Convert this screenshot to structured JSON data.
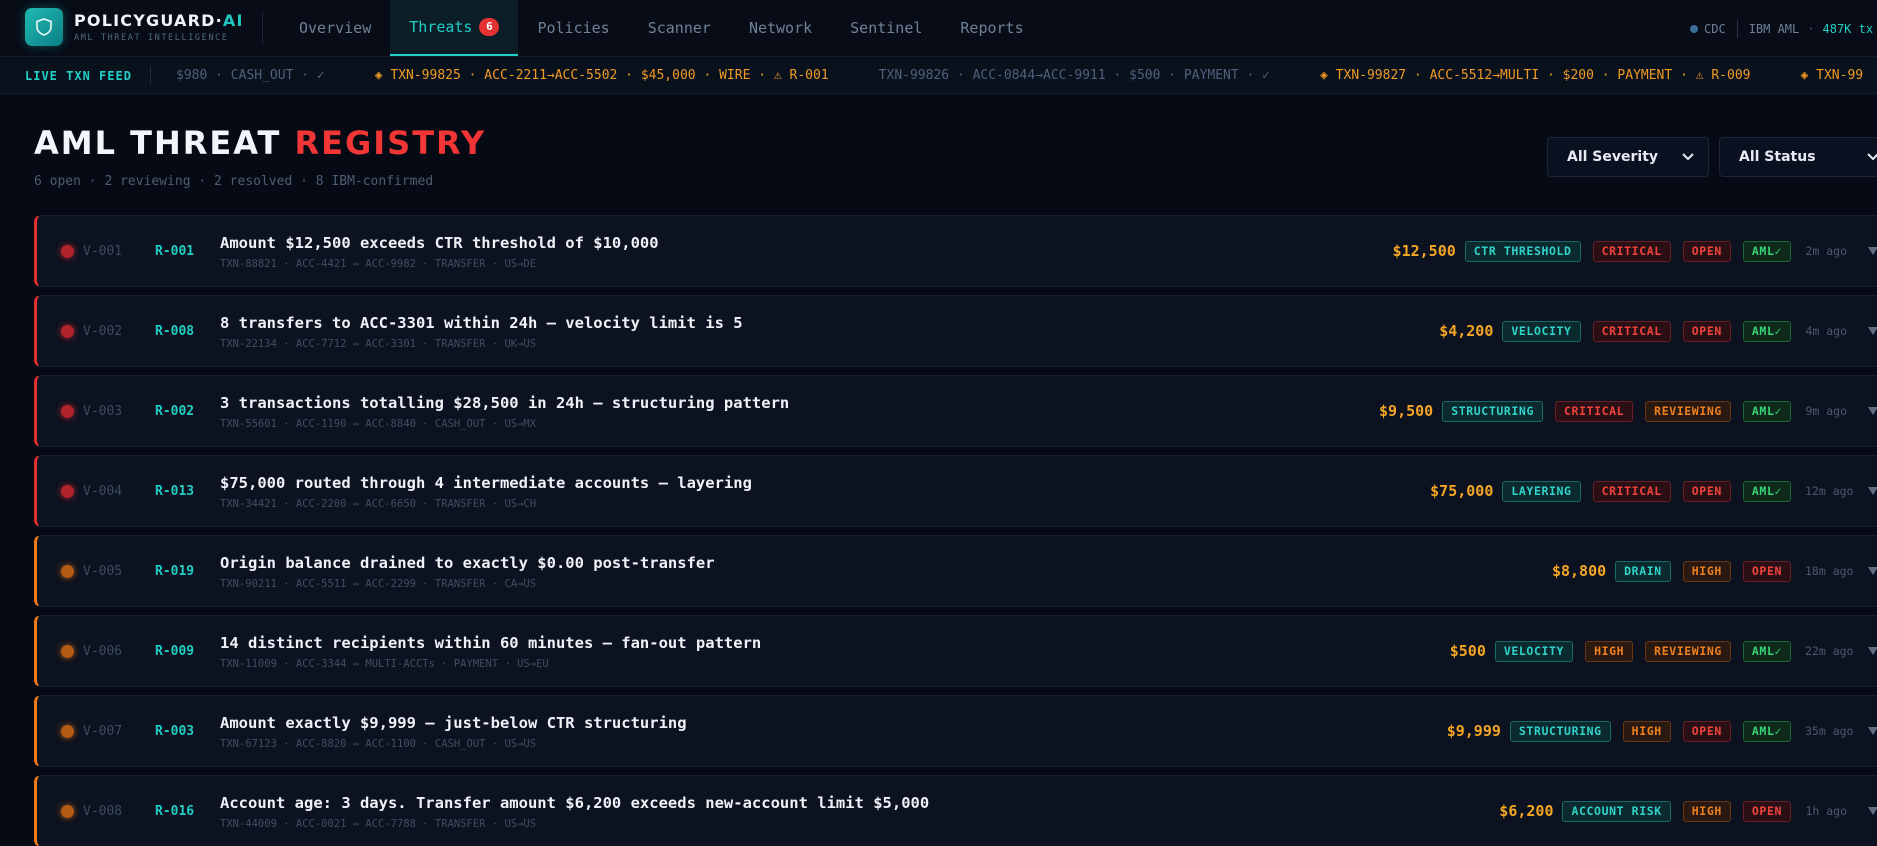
{
  "brand": {
    "name": "POLICYGUARD",
    "accent": "AI",
    "tagline": "AML THREAT INTELLIGENCE"
  },
  "nav": {
    "tabs": [
      "Overview",
      "Threats",
      "Policies",
      "Scanner",
      "Network",
      "Sentinel",
      "Reports"
    ],
    "active": "Threats",
    "threats_badge": "6"
  },
  "top_right": {
    "cdc": "CDC",
    "source": "IBM AML",
    "count": "487K tx"
  },
  "feed": {
    "label": "LIVE TXN FEED",
    "items": [
      "$980 · CASH_OUT · ✓",
      "◈ TXN-99825 · ACC-2211→ACC-5502 · $45,000 · WIRE · ⚠ R-001",
      "TXN-99826 · ACC-0844→ACC-9911 · $500 · PAYMENT · ✓",
      "◈ TXN-99827 · ACC-5512→MULTI · $200 · PAYMENT · ⚠ R-009",
      "◈ TXN-99"
    ]
  },
  "header": {
    "title_main": "AML THREAT",
    "title_accent": "REGISTRY",
    "summary": "6 open · 2 reviewing · 2 resolved · 8 IBM-confirmed"
  },
  "filters": {
    "severity": "All Severity",
    "status": "All Status"
  },
  "threats": [
    {
      "id": "V-001",
      "rule": "R-001",
      "title": "Amount $12,500 exceeds CTR threshold of $10,000",
      "meta": "TXN-88821 · ACC-4421 → ACC-9982 · TRANSFER · US→DE",
      "amount": "$12,500",
      "category": "CTR THRESHOLD",
      "severity": "CRITICAL",
      "status": "OPEN",
      "aml": "AML✓",
      "time": "2m ago"
    },
    {
      "id": "V-002",
      "rule": "R-008",
      "title": "8 transfers to ACC-3301 within 24h — velocity limit is 5",
      "meta": "TXN-22134 · ACC-7712 → ACC-3301 · TRANSFER · UK→US",
      "amount": "$4,200",
      "category": "VELOCITY",
      "severity": "CRITICAL",
      "status": "OPEN",
      "aml": "AML✓",
      "time": "4m ago"
    },
    {
      "id": "V-003",
      "rule": "R-002",
      "title": "3 transactions totalling $28,500 in 24h — structuring pattern",
      "meta": "TXN-55601 · ACC-1190 → ACC-8840 · CASH_OUT · US→MX",
      "amount": "$9,500",
      "category": "STRUCTURING",
      "severity": "CRITICAL",
      "status": "REVIEWING",
      "aml": "AML✓",
      "time": "9m ago"
    },
    {
      "id": "V-004",
      "rule": "R-013",
      "title": "$75,000 routed through 4 intermediate accounts — layering",
      "meta": "TXN-34421 · ACC-2200 → ACC-6650 · TRANSFER · US→CH",
      "amount": "$75,000",
      "category": "LAYERING",
      "severity": "CRITICAL",
      "status": "OPEN",
      "aml": "AML✓",
      "time": "12m ago"
    },
    {
      "id": "V-005",
      "rule": "R-019",
      "title": "Origin balance drained to exactly $0.00 post-transfer",
      "meta": "TXN-90211 · ACC-5511 → ACC-2299 · TRANSFER · CA→US",
      "amount": "$8,800",
      "category": "DRAIN",
      "severity": "HIGH",
      "status": "OPEN",
      "aml": "",
      "time": "18m ago"
    },
    {
      "id": "V-006",
      "rule": "R-009",
      "title": "14 distinct recipients within 60 minutes — fan-out pattern",
      "meta": "TXN-11009 · ACC-3344 → MULTI-ACCTs · PAYMENT · US→EU",
      "amount": "$500",
      "category": "VELOCITY",
      "severity": "HIGH",
      "status": "REVIEWING",
      "aml": "AML✓",
      "time": "22m ago"
    },
    {
      "id": "V-007",
      "rule": "R-003",
      "title": "Amount exactly $9,999 — just-below CTR structuring",
      "meta": "TXN-67123 · ACC-8820 → ACC-1100 · CASH_OUT · US→US",
      "amount": "$9,999",
      "category": "STRUCTURING",
      "severity": "HIGH",
      "status": "OPEN",
      "aml": "AML✓",
      "time": "35m ago"
    },
    {
      "id": "V-008",
      "rule": "R-016",
      "title": "Account age: 3 days. Transfer amount $6,200 exceeds new-account limit $5,000",
      "meta": "TXN-44009 · ACC-0021 → ACC-7788 · TRANSFER · US→US",
      "amount": "$6,200",
      "category": "ACCOUNT RISK",
      "severity": "HIGH",
      "status": "OPEN",
      "aml": "",
      "time": "1h ago"
    }
  ],
  "colors": {
    "accent": "#21cfc6",
    "critical": "#e23030",
    "high": "#ef7a16",
    "amount": "#f5a623",
    "confirmed": "#37d474"
  }
}
